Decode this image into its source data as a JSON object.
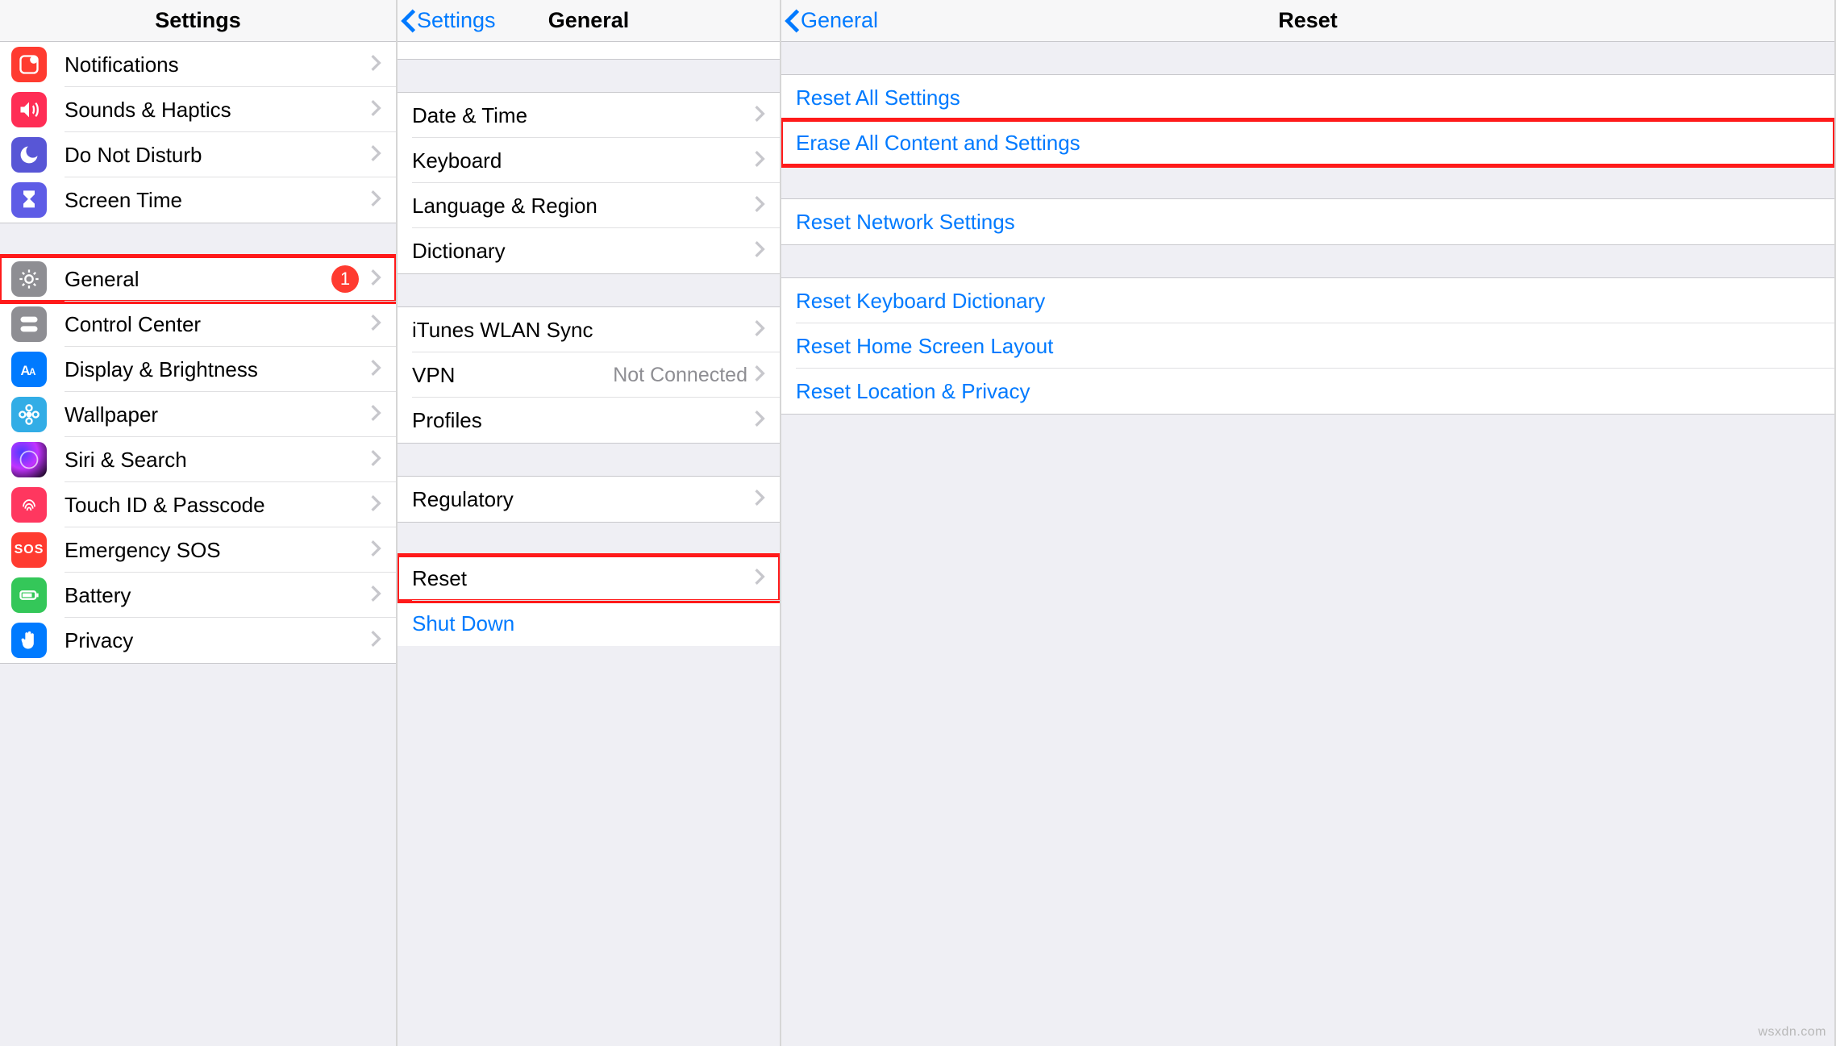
{
  "watermark": "wsxdn.com",
  "settings": {
    "title": "Settings",
    "items_a": [
      {
        "key": "notifications",
        "label": "Notifications"
      },
      {
        "key": "sounds",
        "label": "Sounds & Haptics"
      },
      {
        "key": "dnd",
        "label": "Do Not Disturb"
      },
      {
        "key": "screentime",
        "label": "Screen Time"
      }
    ],
    "items_b": [
      {
        "key": "general",
        "label": "General",
        "badge": "1",
        "highlight": true
      },
      {
        "key": "controlcenter",
        "label": "Control Center"
      },
      {
        "key": "display",
        "label": "Display & Brightness"
      },
      {
        "key": "wallpaper",
        "label": "Wallpaper"
      },
      {
        "key": "siri",
        "label": "Siri & Search"
      },
      {
        "key": "touchid",
        "label": "Touch ID & Passcode"
      },
      {
        "key": "sos",
        "label": "Emergency SOS"
      },
      {
        "key": "battery",
        "label": "Battery"
      },
      {
        "key": "privacy",
        "label": "Privacy"
      }
    ]
  },
  "general": {
    "back": "Settings",
    "title": "General",
    "items_a": [
      {
        "key": "datetime",
        "label": "Date & Time"
      },
      {
        "key": "keyboard",
        "label": "Keyboard"
      },
      {
        "key": "lang",
        "label": "Language & Region"
      },
      {
        "key": "dict",
        "label": "Dictionary"
      }
    ],
    "items_b": [
      {
        "key": "itunes",
        "label": "iTunes WLAN Sync"
      },
      {
        "key": "vpn",
        "label": "VPN",
        "detail": "Not Connected"
      },
      {
        "key": "profiles",
        "label": "Profiles"
      }
    ],
    "items_c": [
      {
        "key": "regulatory",
        "label": "Regulatory"
      }
    ],
    "items_d": [
      {
        "key": "reset",
        "label": "Reset",
        "highlight": true
      }
    ],
    "shutdown": "Shut Down"
  },
  "reset": {
    "back": "General",
    "title": "Reset",
    "items_a": [
      {
        "key": "resetall",
        "label": "Reset All Settings"
      },
      {
        "key": "eraseall",
        "label": "Erase All Content and Settings",
        "highlight": true
      }
    ],
    "items_b": [
      {
        "key": "resetnetwork",
        "label": "Reset Network Settings"
      }
    ],
    "items_c": [
      {
        "key": "resetkb",
        "label": "Reset Keyboard Dictionary"
      },
      {
        "key": "resethome",
        "label": "Reset Home Screen Layout"
      },
      {
        "key": "resetloc",
        "label": "Reset Location & Privacy"
      }
    ]
  }
}
